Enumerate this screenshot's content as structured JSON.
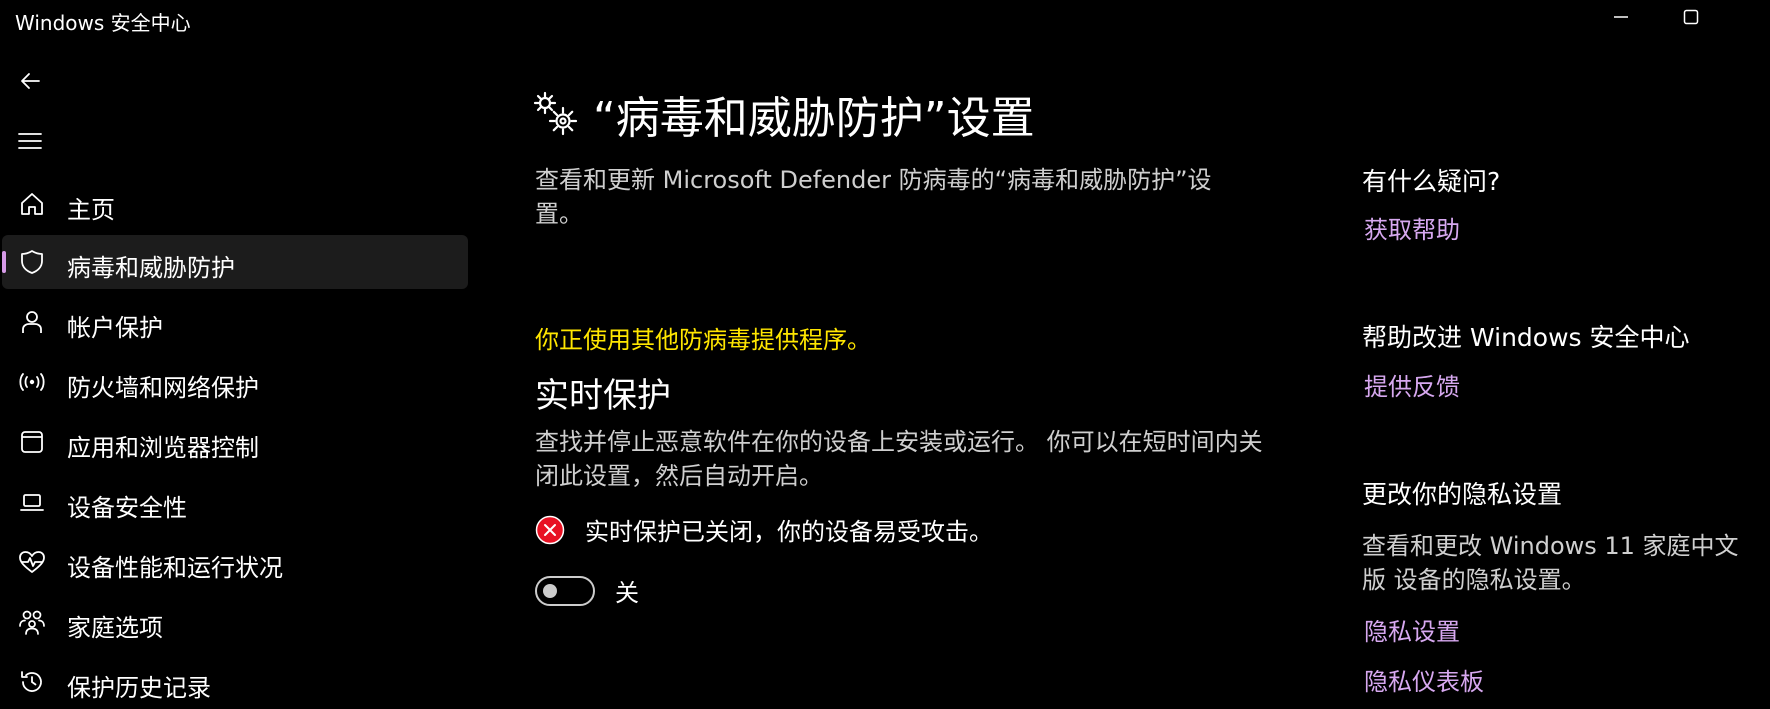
{
  "window": {
    "title": "Windows 安全中心"
  },
  "sidebar": {
    "items": [
      {
        "label": "主页",
        "icon": "home-icon"
      },
      {
        "label": "病毒和威胁防护",
        "icon": "shield-icon",
        "active": true
      },
      {
        "label": "帐户保护",
        "icon": "person-icon"
      },
      {
        "label": "防火墙和网络保护",
        "icon": "wifi-antenna-icon"
      },
      {
        "label": "应用和浏览器控制",
        "icon": "app-window-icon"
      },
      {
        "label": "设备安全性",
        "icon": "laptop-icon"
      },
      {
        "label": "设备性能和运行状况",
        "icon": "heart-pulse-icon"
      },
      {
        "label": "家庭选项",
        "icon": "family-icon"
      },
      {
        "label": "保护历史记录",
        "icon": "history-icon"
      }
    ]
  },
  "main": {
    "title": "“病毒和威胁防护”设置",
    "description": "查看和更新 Microsoft Defender 防病毒的“病毒和威胁防护”设置。",
    "warning": "你正使用其他防病毒提供程序。",
    "realtime": {
      "title": "实时保护",
      "description": "查找并停止恶意软件在你的设备上安装或运行。 你可以在短时间内关闭此设置，然后自动开启。",
      "status": "实时保护已关闭，你的设备易受攻击。",
      "toggle_label": "关",
      "toggle_on": false
    }
  },
  "side_panel": {
    "question_heading": "有什么疑问?",
    "help_link": "获取帮助",
    "improve_heading": "帮助改进 Windows 安全中心",
    "feedback_link": "提供反馈",
    "privacy_heading": "更改你的隐私设置",
    "privacy_text": "查看和更改 Windows 11 家庭中文版 设备的隐私设置。",
    "privacy_settings_link": "隐私设置",
    "privacy_dashboard_link": "隐私仪表板"
  },
  "colors": {
    "background": "#000000",
    "accent": "#d69be8",
    "link": "#d7a8f0",
    "warning": "#ffe600",
    "error": "#e81123"
  }
}
